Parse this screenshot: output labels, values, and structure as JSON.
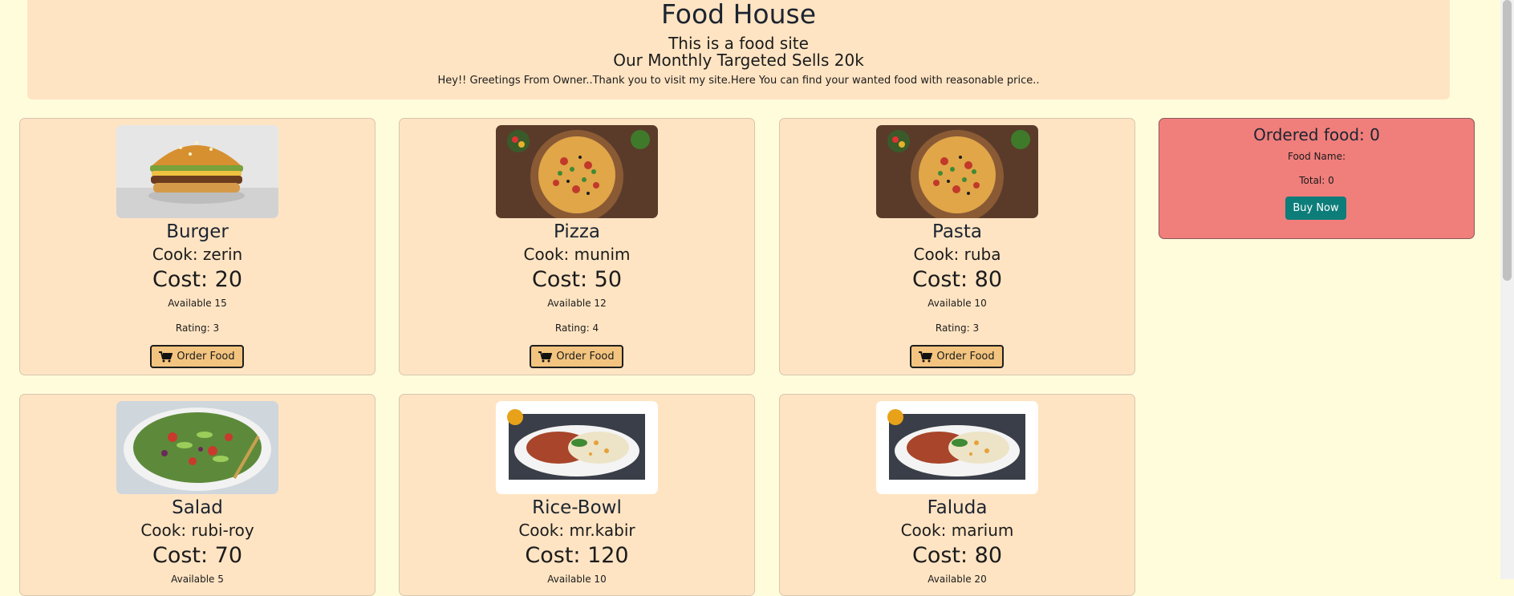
{
  "header": {
    "title": "Food House",
    "subtitle": "This is a food site",
    "target": "Our Monthly Targeted Sells 20k",
    "greeting": "Hey!! Greetings From Owner..Thank you to visit my site.Here You can find your wanted food with reasonable price.."
  },
  "foods": [
    {
      "name": "Burger",
      "cook": "Cook: zerin",
      "cost": "Cost: 20",
      "available": "Available 15",
      "rating": "Rating: 3",
      "order_label": "Order Food"
    },
    {
      "name": "Pizza",
      "cook": "Cook: munim",
      "cost": "Cost: 50",
      "available": "Available 12",
      "rating": "Rating: 4",
      "order_label": "Order Food"
    },
    {
      "name": "Pasta",
      "cook": "Cook: ruba",
      "cost": "Cost: 80",
      "available": "Available 10",
      "rating": "Rating: 3",
      "order_label": "Order Food"
    },
    {
      "name": "Salad",
      "cook": "Cook: rubi-roy",
      "cost": "Cost: 70",
      "available": "Available 5"
    },
    {
      "name": "Rice-Bowl",
      "cook": "Cook: mr.kabir",
      "cost": "Cost: 120",
      "available": "Available 10"
    },
    {
      "name": "Faluda",
      "cook": "Cook: marium",
      "cost": "Cost: 80",
      "available": "Available 20"
    }
  ],
  "order": {
    "title": "Ordered food: 0",
    "food_name": "Food Name:",
    "total": "Total: 0",
    "buy_label": "Buy Now"
  }
}
